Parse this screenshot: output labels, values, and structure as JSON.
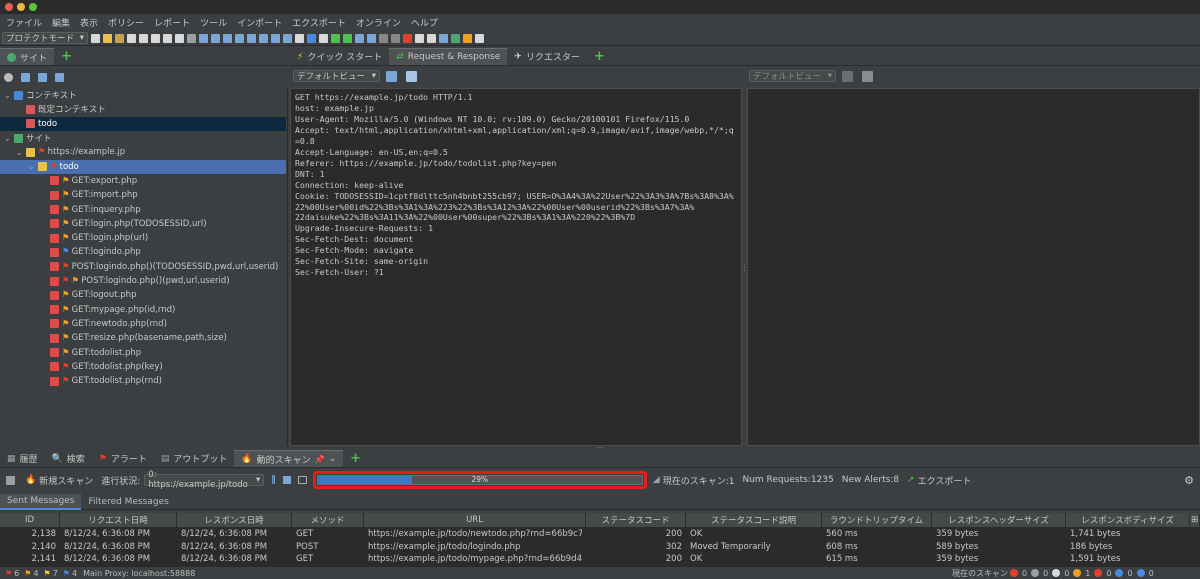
{
  "menu": [
    "ファイル",
    "編集",
    "表示",
    "ポリシー",
    "レポート",
    "ツール",
    "インポート",
    "エクスポート",
    "オンライン",
    "ヘルプ"
  ],
  "toolbar": {
    "mode": "プロテクトモード"
  },
  "left_tab": "サイト",
  "top_tabs": [
    {
      "label": "クイック スタート"
    },
    {
      "label": "Request & Response"
    },
    {
      "label": "リクエスター"
    }
  ],
  "view_combo_left": "デフォルトビュー",
  "view_combo_right": "デフォルトビュー",
  "tree": [
    {
      "label": "コンテキスト",
      "indent": 0,
      "icon": "#4a88d4",
      "exp": "v"
    },
    {
      "label": "既定コンテキスト",
      "indent": 1,
      "icon": "#d45a5a",
      "exp": ""
    },
    {
      "label": "todo",
      "indent": 1,
      "icon": "#d45a5a",
      "exp": "",
      "sel": "sel2"
    },
    {
      "label": "サイト",
      "indent": 0,
      "icon": "#4aa870",
      "exp": "v"
    },
    {
      "label": "https://example.jp",
      "indent": 1,
      "icon": "#e8c14a",
      "exp": "v",
      "flag": "#e2402d"
    },
    {
      "label": "todo",
      "indent": 2,
      "icon": "#e8c14a",
      "exp": "v",
      "flag": "#e2402d",
      "sel": "sel"
    },
    {
      "label": "GET:export.php",
      "indent": 3,
      "icon": "#e04a4a",
      "flag": "#f0a020"
    },
    {
      "label": "GET:import.php",
      "indent": 3,
      "icon": "#e04a4a",
      "flag": "#f0a020"
    },
    {
      "label": "GET:inquery.php",
      "indent": 3,
      "icon": "#e04a4a",
      "flag": "#f0a020"
    },
    {
      "label": "GET:login.php(TODOSESSID,url)",
      "indent": 3,
      "icon": "#e04a4a",
      "flag": "#f0a020"
    },
    {
      "label": "GET:login.php(url)",
      "indent": 3,
      "icon": "#e04a4a",
      "flag": "#f0a020"
    },
    {
      "label": "GET:logindo.php",
      "indent": 3,
      "icon": "#e04a4a",
      "flag": "#4a8ae0"
    },
    {
      "label": "POST:logindo.php()(TODOSESSID,pwd,url,userid)",
      "indent": 3,
      "icon": "#e04a4a",
      "flag": "#e2402d"
    },
    {
      "label": "POST:logindo.php()(pwd,url,userid)",
      "indent": 3,
      "icon": "#e04a4a",
      "flag": "#e2402d",
      "flag2": "#f0a020"
    },
    {
      "label": "GET:logout.php",
      "indent": 3,
      "icon": "#e04a4a",
      "flag": "#f0a020"
    },
    {
      "label": "GET:mypage.php(id,rnd)",
      "indent": 3,
      "icon": "#e04a4a",
      "flag": "#f0a020"
    },
    {
      "label": "GET:newtodo.php(rnd)",
      "indent": 3,
      "icon": "#e04a4a",
      "flag": "#f0a020"
    },
    {
      "label": "GET:resize.php(basename,path,size)",
      "indent": 3,
      "icon": "#e04a4a",
      "flag": "#f0a020"
    },
    {
      "label": "GET:todolist.php",
      "indent": 3,
      "icon": "#e04a4a",
      "flag": "#f0a020"
    },
    {
      "label": "GET:todolist.php(key)",
      "indent": 3,
      "icon": "#e04a4a",
      "flag": "#e2402d"
    },
    {
      "label": "GET:todolist.php(rnd)",
      "indent": 3,
      "icon": "#e04a4a",
      "flag": "#e2402d"
    }
  ],
  "request_lines": [
    "GET https://example.jp/todo HTTP/1.1",
    "host: example.jp",
    "User-Agent: Mozilla/5.0 (Windows NT 10.0; rv:109.0) Gecko/20100101 Firefox/115.0",
    "Accept: text/html,application/xhtml+xml,application/xml;q=0.9,image/avif,image/webp,*/*;q",
    "=0.8",
    "Accept-Language: en-US,en;q=0.5",
    "Referer: https://example.jp/todo/todolist.php?key=pen",
    "DNT: 1",
    "Connection: keep-alive",
    "Cookie: TODOSESSID=1cptf8dlttc5nh4bnbt255cb97; USER=O%3A4%3A%22User%22%3A3%3A%7Bs%3A8%3A%",
    "22%00User%00id%22%3Bs%3A1%3A%223%22%3Bs%3A12%3A%22%00User%00userid%22%3Bs%3A7%3A%",
    "22daisuke%22%3Bs%3A11%3A%22%00User%00super%22%3Bs%3A1%3A%220%22%3B%7D",
    "Upgrade-Insecure-Requests: 1",
    "Sec-Fetch-Dest: document",
    "Sec-Fetch-Mode: navigate",
    "Sec-Fetch-Site: same-origin",
    "Sec-Fetch-User: ?1"
  ],
  "bottom_tabs": [
    {
      "label": "履歴",
      "icon": "#9aa0a6"
    },
    {
      "label": "検索",
      "icon": "#9aa0a6"
    },
    {
      "label": "アラート",
      "icon": "#e2402d"
    },
    {
      "label": "アウトプット",
      "icon": "#9aa0a6"
    },
    {
      "label": "動的スキャン",
      "icon": "#f0a020"
    }
  ],
  "scan": {
    "new_scan": "新規スキャン",
    "progress_label": "進行状況:",
    "target": "0: https://example.jp/todo",
    "progress": 0.29,
    "progress_text": "29%",
    "current_scans": "現在のスキャン:1",
    "num_requests": "Num Requests:1235",
    "new_alerts": "New Alerts:8",
    "export": "エクスポート"
  },
  "sub_tabs": [
    "Sent Messages",
    "Filtered Messages"
  ],
  "columns": [
    "ID",
    "リクエスト日時",
    "レスポンス日時",
    "メソッド",
    "URL",
    "ステータスコード",
    "ステータスコード説明",
    "ラウンドトリップタイム",
    "レスポンスヘッダーサイズ",
    "レスポンスボディサイズ"
  ],
  "rows": [
    [
      "2,138",
      "8/12/24, 6:36:08 PM",
      "8/12/24, 6:36:08 PM",
      "GET",
      "https://example.jp/todo/newtodo.php?rnd=66b9c7d...",
      "200",
      "OK",
      "560 ms",
      "359 bytes",
      "1,741 bytes"
    ],
    [
      "2,140",
      "8/12/24, 6:36:08 PM",
      "8/12/24, 6:36:08 PM",
      "POST",
      "https://example.jp/todo/logindo.php",
      "302",
      "Moved Temporarily",
      "608 ms",
      "589 bytes",
      "186 bytes"
    ],
    [
      "2,141",
      "8/12/24, 6:36:08 PM",
      "8/12/24, 6:36:08 PM",
      "GET",
      "https://example.jp/todo/mypage.php?rnd=66b9d42...",
      "200",
      "OK",
      "615 ms",
      "359 bytes",
      "1,591 bytes"
    ]
  ],
  "statusbar": {
    "alerts": [
      "6",
      "4",
      "7",
      "4"
    ],
    "proxy": "Main Proxy: localhost:58888",
    "current_scan": "現在のスキャン",
    "right_counts": [
      "0",
      "0",
      "0",
      "1",
      "0",
      "0",
      "0"
    ]
  }
}
